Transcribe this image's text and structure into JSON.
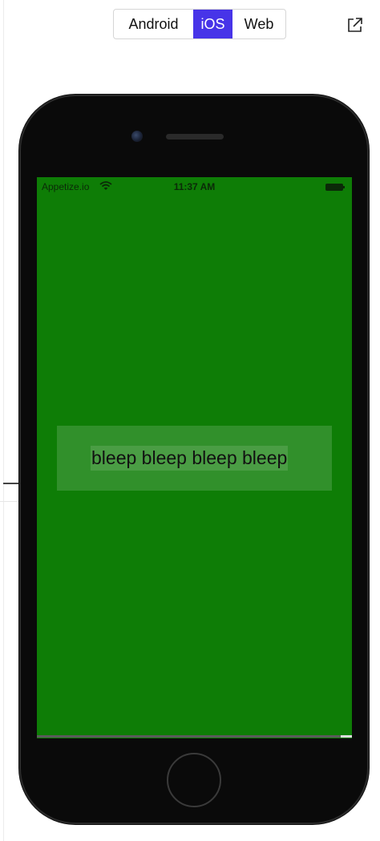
{
  "platform_toggle": {
    "options": [
      {
        "label": "Android",
        "selected": false
      },
      {
        "label": "iOS",
        "selected": true
      },
      {
        "label": "Web",
        "selected": false
      }
    ],
    "selected_color": "#4734e8"
  },
  "external_link_icon": "external-link-icon",
  "device": {
    "status_bar": {
      "carrier": "Appetize.io",
      "time": "11:37 AM",
      "wifi_icon": "wifi-icon",
      "battery_icon": "battery-icon"
    },
    "screen_color": "#0e7d06",
    "content_text": "bleep bleep bleep bleep"
  }
}
